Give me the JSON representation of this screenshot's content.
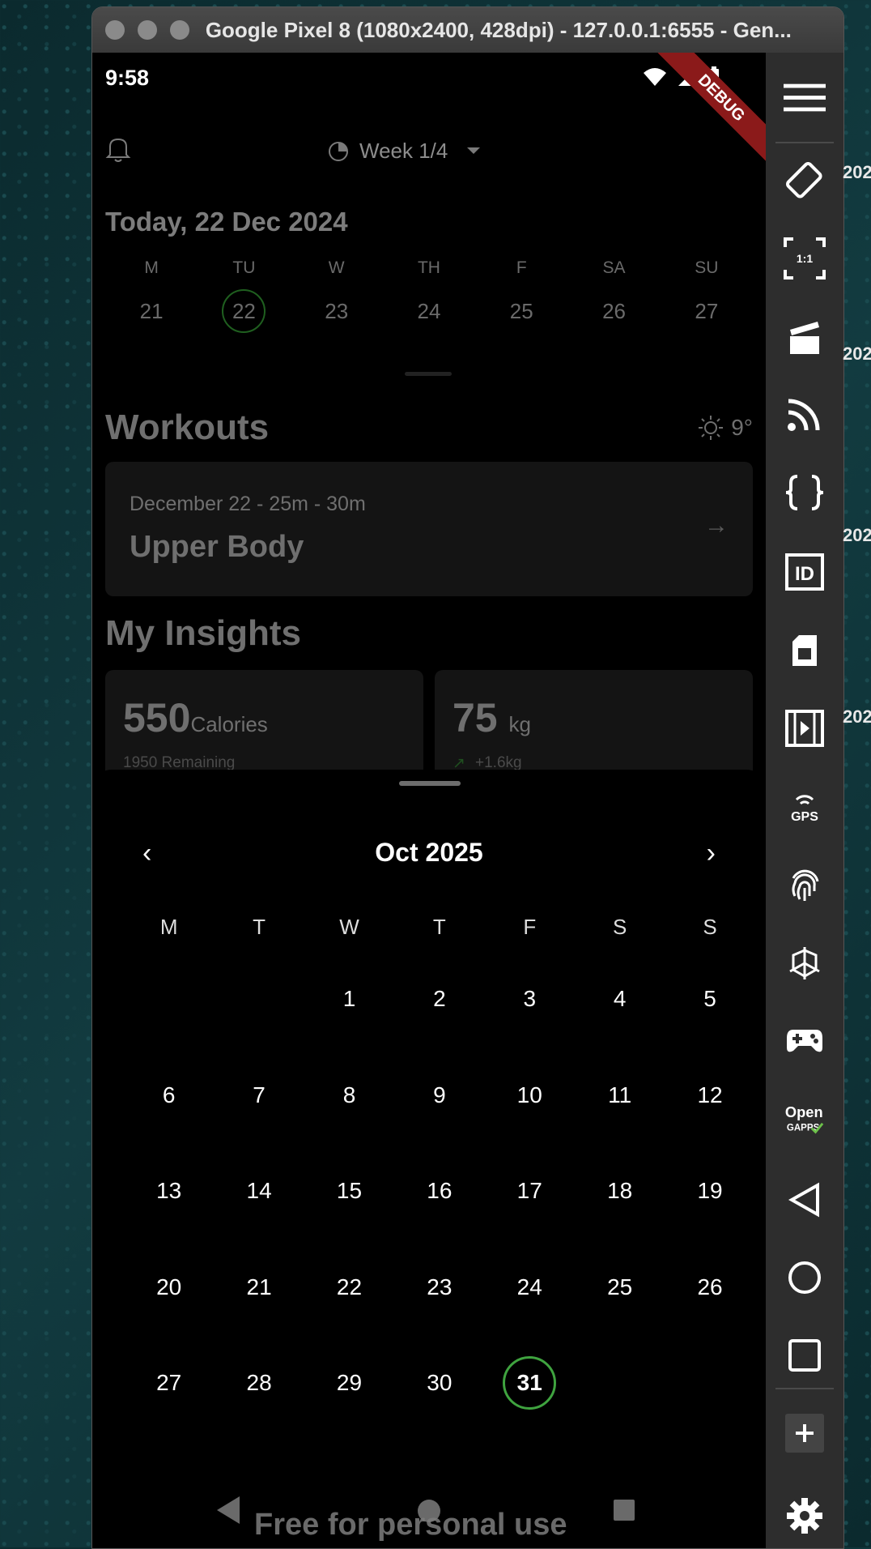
{
  "window": {
    "title": "Google Pixel 8 (1080x2400, 428dpi) - 127.0.0.1:6555 - Gen..."
  },
  "status": {
    "time": "9:58",
    "debug": "DEBUG"
  },
  "header": {
    "week_label": "Week 1/4"
  },
  "today_label": "Today, 22 Dec 2024",
  "week_strip": {
    "days": [
      "M",
      "TU",
      "W",
      "TH",
      "F",
      "SA",
      "SU"
    ],
    "dates": [
      "21",
      "22",
      "23",
      "24",
      "25",
      "26",
      "27"
    ],
    "selected_index": 1
  },
  "workouts": {
    "title": "Workouts",
    "weather": "9°",
    "card": {
      "subtitle": "December 22 - 25m - 30m",
      "name": "Upper Body"
    }
  },
  "insights": {
    "title": "My Insights",
    "calories": {
      "value": "550",
      "unit": "Calories",
      "note": "1950 Remaining"
    },
    "weight": {
      "value": "75",
      "unit": "kg",
      "note": "+1.6kg"
    }
  },
  "calendar": {
    "month_label": "Oct 2025",
    "weekdays": [
      "M",
      "T",
      "W",
      "T",
      "F",
      "S",
      "S"
    ],
    "weeks": [
      [
        "",
        "",
        "1",
        "2",
        "3",
        "4",
        "5"
      ],
      [
        "6",
        "7",
        "8",
        "9",
        "10",
        "11",
        "12"
      ],
      [
        "13",
        "14",
        "15",
        "16",
        "17",
        "18",
        "19"
      ],
      [
        "20",
        "21",
        "22",
        "23",
        "24",
        "25",
        "26"
      ],
      [
        "27",
        "28",
        "29",
        "30",
        "31",
        "",
        ""
      ]
    ],
    "selected": "31",
    "selected_color": "#3fa33f"
  },
  "watermark": "Free for personal use",
  "toolbar": {
    "items": [
      "menu-icon",
      "rotate-icon",
      "pixel-ratio-icon",
      "clapper-icon",
      "cast-icon",
      "braces-icon",
      "id-icon",
      "sim-card-icon",
      "film-icon",
      "gps-icon",
      "fingerprint-icon",
      "sensor-icon",
      "gamepad-icon",
      "open-gapps-icon",
      "back-icon",
      "home-icon",
      "overview-icon",
      "plus-icon",
      "settings-icon"
    ],
    "id_label": "ID",
    "gps_label": "GPS",
    "gapps_label": "Open GAPPS",
    "pixel_ratio_label": "1:1"
  },
  "edge_texts": [
    "202",
    "202",
    "202",
    "202"
  ]
}
